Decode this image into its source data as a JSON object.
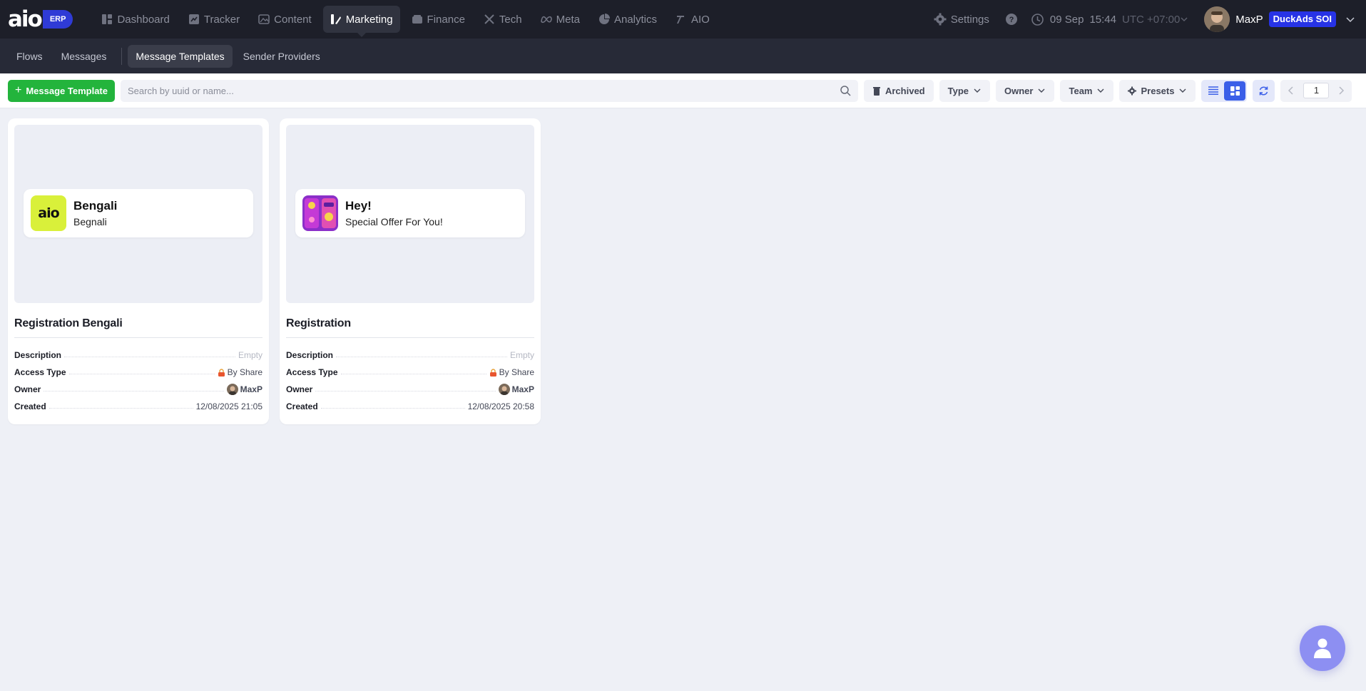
{
  "app": {
    "logo": "aio",
    "logo_badge": "ERP"
  },
  "nav": {
    "items": [
      {
        "label": "Dashboard",
        "icon": "dashboard-icon"
      },
      {
        "label": "Tracker",
        "icon": "tracker-icon"
      },
      {
        "label": "Content",
        "icon": "image-icon"
      },
      {
        "label": "Marketing",
        "icon": "marketing-icon",
        "active": true
      },
      {
        "label": "Finance",
        "icon": "wallet-icon"
      },
      {
        "label": "Tech",
        "icon": "tools-icon"
      },
      {
        "label": "Meta",
        "icon": "meta-icon"
      },
      {
        "label": "Analytics",
        "icon": "pie-chart-icon"
      },
      {
        "label": "AIO",
        "icon": "aio-icon"
      }
    ],
    "settings_label": "Settings",
    "date": "09 Sep",
    "time": "15:44",
    "timezone": "UTC +07:00",
    "user_name": "MaxP",
    "team_badge": "DuckAds SOI"
  },
  "subnav": {
    "items": [
      {
        "label": "Flows"
      },
      {
        "label": "Messages"
      },
      {
        "label": "Message Templates",
        "active": true
      },
      {
        "label": "Sender Providers"
      }
    ]
  },
  "toolbar": {
    "add_label": "Message Template",
    "search_placeholder": "Search by uuid or name...",
    "archived_label": "Archived",
    "type_label": "Type",
    "owner_label": "Owner",
    "team_label": "Team",
    "presets_label": "Presets",
    "page": "1"
  },
  "cards": [
    {
      "notif_title": "Bengali",
      "notif_body": "Begnali",
      "notif_icon_text": "aio",
      "title": "Registration Bengali",
      "description_label": "Description",
      "description": "Empty",
      "access_label": "Access Type",
      "access": "By Share",
      "owner_label": "Owner",
      "owner": "MaxP",
      "created_label": "Created",
      "created": "12/08/2025 21:05"
    },
    {
      "notif_title": "Hey!",
      "notif_body": "Special Offer For You!",
      "title": "Registration",
      "description_label": "Description",
      "description": "Empty",
      "access_label": "Access Type",
      "access": "By Share",
      "owner_label": "Owner",
      "owner": "MaxP",
      "created_label": "Created",
      "created": "12/08/2025 20:58"
    }
  ],
  "colors": {
    "topbar": "#1d1f29",
    "accent_green": "#23b43c",
    "accent_blue": "#3b5fe8",
    "team_badge": "#2733e6",
    "fab": "#8d8ff2"
  }
}
